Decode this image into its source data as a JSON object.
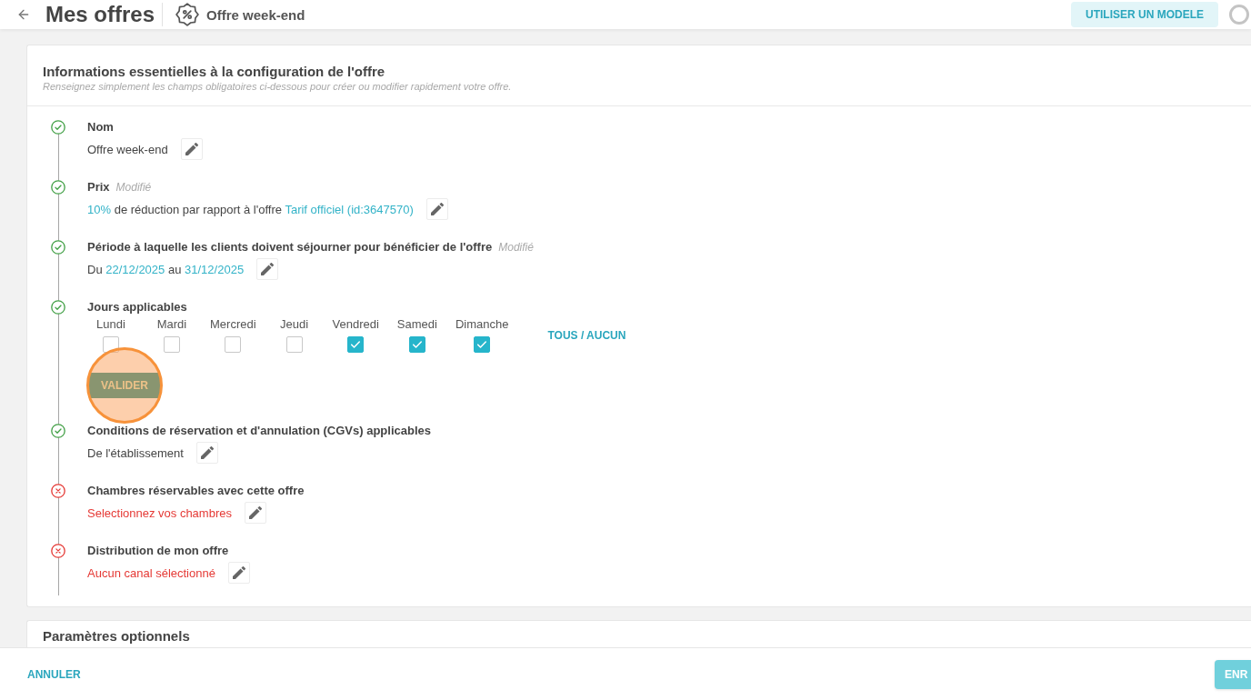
{
  "header": {
    "title": "Mes offres",
    "offer_name": "Offre week-end",
    "template_button": "UTILISER UN MODELE"
  },
  "main_card": {
    "title": "Informations essentielles à la configuration de l'offre",
    "subtitle": "Renseignez simplement les champs obligatoires ci-dessous pour créer ou modifier rapidement votre offre.",
    "steps": [
      {
        "kind": "text",
        "complete": true,
        "label": "Nom",
        "value": [
          {
            "text": "Offre week-end",
            "highlight": false
          }
        ]
      },
      {
        "kind": "text",
        "complete": true,
        "label": "Prix",
        "note": "Modifié",
        "value": [
          {
            "text": "10%",
            "highlight": true
          },
          {
            "text": "de réduction par rapport à l'offre",
            "highlight": false
          },
          {
            "text": "Tarif officiel (id:3647570)",
            "highlight": true
          }
        ]
      },
      {
        "kind": "text",
        "complete": true,
        "label": "Période à laquelle les clients doivent séjourner pour bénéficier de l'offre",
        "note": "Modifié",
        "value": [
          {
            "text": "Du",
            "highlight": false
          },
          {
            "text": "22/12/2025",
            "highlight": true
          },
          {
            "text": "au",
            "highlight": false
          },
          {
            "text": "31/12/2025",
            "highlight": true
          }
        ]
      },
      {
        "kind": "days",
        "complete": true,
        "label": "Jours applicables",
        "days": [
          {
            "label": "Lundi",
            "checked": false
          },
          {
            "label": "Mardi",
            "checked": false
          },
          {
            "label": "Mercredi",
            "checked": false
          },
          {
            "label": "Jeudi",
            "checked": false
          },
          {
            "label": "Vendredi",
            "checked": true
          },
          {
            "label": "Samedi",
            "checked": true
          },
          {
            "label": "Dimanche",
            "checked": true
          }
        ],
        "toggle_all": "TOUS / AUCUN",
        "confirm_button": "VALIDER"
      },
      {
        "kind": "text",
        "complete": true,
        "label": "Conditions de réservation et d'annulation (CGVs) applicables",
        "value": [
          {
            "text": "De l'établissement",
            "highlight": false
          }
        ]
      },
      {
        "kind": "text",
        "complete": false,
        "label": "Chambres réservables avec cette offre",
        "value": [
          {
            "text": "Selectionnez vos chambres",
            "highlight": false
          }
        ]
      },
      {
        "kind": "text",
        "complete": false,
        "label": "Distribution de mon offre",
        "value": [
          {
            "text": "Aucun canal sélectionné",
            "highlight": false
          }
        ]
      }
    ]
  },
  "optional_card": {
    "title": "Paramètres optionnels"
  },
  "footer": {
    "cancel_button": "ANNULER",
    "save_button": "ENR"
  }
}
